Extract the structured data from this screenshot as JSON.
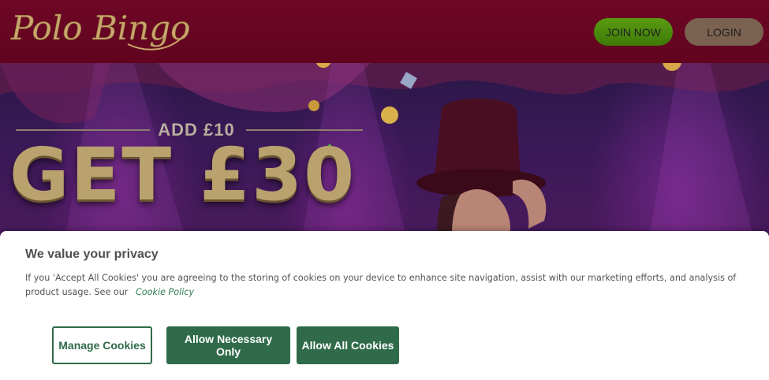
{
  "header": {
    "logo_text": "Polo Bingo",
    "join_label": "JOIN NOW",
    "login_label": "LOGIN"
  },
  "hero": {
    "subtitle": "ADD £10",
    "headline": "GET £30"
  },
  "cookie_banner": {
    "title": "We value your privacy",
    "body": "If you 'Accept All Cookies' you are agreeing to the storing of cookies on your device to enhance site navigation, assist with our marketing efforts, and analysis of product usage. See our",
    "link_label": "Cookie Policy",
    "buttons": {
      "manage": "Manage Cookies",
      "necessary": "Allow Necessary Only",
      "all": "Allow All Cookies"
    }
  },
  "colors": {
    "header_bg": "#6d0725",
    "join_bg": "#4c8c0c",
    "login_bg": "#7a6150",
    "cookie_green": "#2f6b4a",
    "headline_gold": "#b9a26e"
  }
}
